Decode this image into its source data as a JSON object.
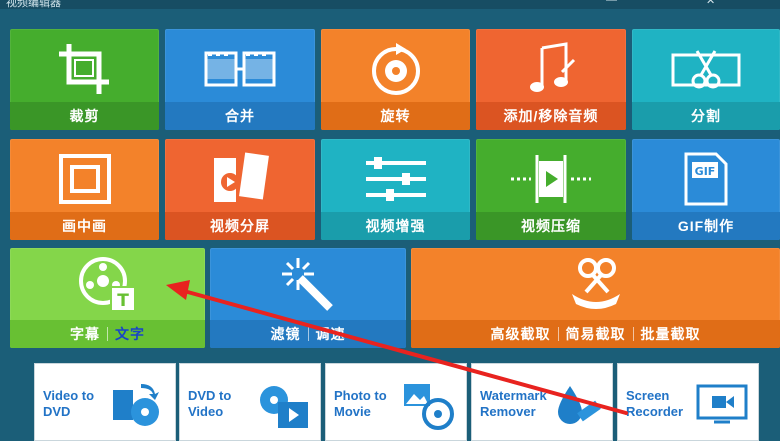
{
  "window": {
    "title": "视频编辑器",
    "controls": [
      "✕"
    ]
  },
  "tiles_row1": [
    {
      "label": "裁剪",
      "icon": "crop-icon",
      "color": "#45ad2d"
    },
    {
      "label": "合并",
      "icon": "merge-film-icon",
      "color": "#2b8bd8"
    },
    {
      "label": "旋转",
      "icon": "rotate-icon",
      "color": "#f3822a"
    },
    {
      "label": "添加/移除音频",
      "icon": "music-note-icon",
      "color": "#ef6531"
    },
    {
      "label": "分割",
      "icon": "split-scissors-icon",
      "color": "#1fb3c3"
    }
  ],
  "tiles_row2": [
    {
      "label": "画中画",
      "icon": "picture-in-picture-icon",
      "color": "#f3822a"
    },
    {
      "label": "视频分屏",
      "icon": "split-screen-icon",
      "color": "#ef6531"
    },
    {
      "label": "视频增强",
      "icon": "sliders-icon",
      "color": "#1fb3c3"
    },
    {
      "label": "视频压缩",
      "icon": "compress-icon",
      "color": "#45ad2d"
    },
    {
      "label": "GIF制作",
      "icon": "gif-icon",
      "color": "#2b8bd8"
    }
  ],
  "tiles_row3": {
    "subtitle": {
      "label_a": "字幕",
      "label_b": "文字"
    },
    "filter": {
      "label_a": "滤镜",
      "label_b": "调速"
    },
    "trim": {
      "label_a": "高级截取",
      "label_b": "简易截取",
      "label_c": "批量截取"
    }
  },
  "bottom_bar": [
    {
      "line1": "Video to",
      "line2": "DVD",
      "icon": "video-to-dvd-icon"
    },
    {
      "line1": "DVD to",
      "line2": "Video",
      "icon": "dvd-to-video-icon"
    },
    {
      "line1": "Photo to",
      "line2": "Movie",
      "icon": "photo-to-movie-icon"
    },
    {
      "line1": "Watermark",
      "line2": "Remover",
      "icon": "watermark-remover-icon"
    },
    {
      "line1": "Screen",
      "line2": "Recorder",
      "icon": "screen-recorder-icon"
    }
  ],
  "annotation": {
    "arrow_color": "#e8231f"
  }
}
